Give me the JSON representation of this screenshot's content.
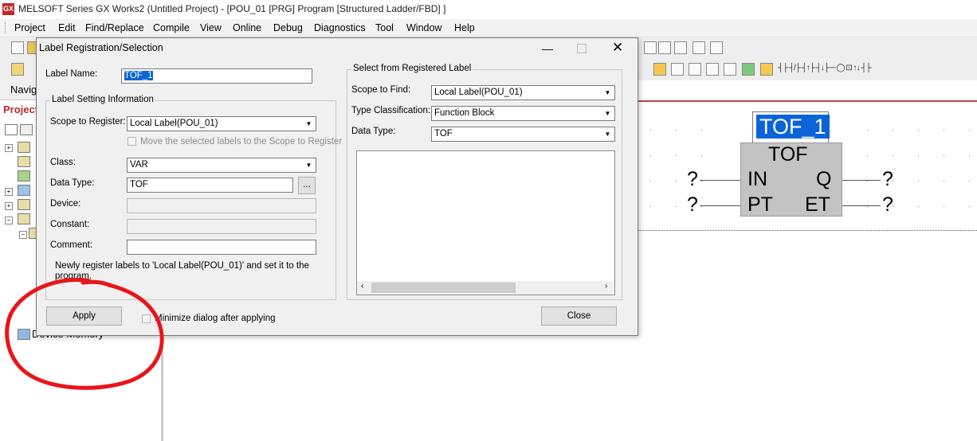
{
  "app": {
    "title": "MELSOFT Series GX Works2 (Untitled Project) - [POU_01 [PRG] Program [Structured Ladder/FBD] ]",
    "icon_text": "GX"
  },
  "menu": [
    "Project",
    "Edit",
    "Find/Replace",
    "Compile",
    "View",
    "Online",
    "Debug",
    "Diagnostics",
    "Tool",
    "Window",
    "Help"
  ],
  "navigation": {
    "title": "Navig",
    "tab": "Project",
    "device_memory": "Device Memory"
  },
  "editor": {
    "instance_name": "TOF_1",
    "fb_type": "TOF",
    "inputs": [
      "IN",
      "PT"
    ],
    "outputs": [
      "Q",
      "ET"
    ],
    "unassigned": "?"
  },
  "dialog": {
    "title": "Label Registration/Selection",
    "label_name_caption": "Label Name:",
    "label_name_value": "TOF_1",
    "setting_group_title": "Label Setting Information",
    "scope_register_caption": "Scope to Register:",
    "scope_register_value": "Local Label(POU_01)",
    "move_checkbox_label": "Move the selected labels to the Scope to Register",
    "class_caption": "Class:",
    "class_value": "VAR",
    "data_type_caption": "Data Type:",
    "data_type_value": "TOF",
    "browse_button": "...",
    "device_caption": "Device:",
    "constant_caption": "Constant:",
    "comment_caption": "Comment:",
    "info_text": "Newly register labels to 'Local Label(POU_01)' and set it to the program.",
    "select_group_title": "Select from Registered Label",
    "scope_find_caption": "Scope to Find:",
    "scope_find_value": "Local Label(POU_01)",
    "type_class_caption": "Type Classification:",
    "type_class_value": "Function Block",
    "select_data_type_caption": "Data Type:",
    "select_data_type_value": "TOF",
    "apply_button": "Apply",
    "minimize_checkbox_label": "Minimize dialog after applying",
    "close_button": "Close"
  },
  "colors": {
    "selection": "#0a64d8",
    "annotation": "#e8151b",
    "fb_body": "#c3c3c3"
  }
}
